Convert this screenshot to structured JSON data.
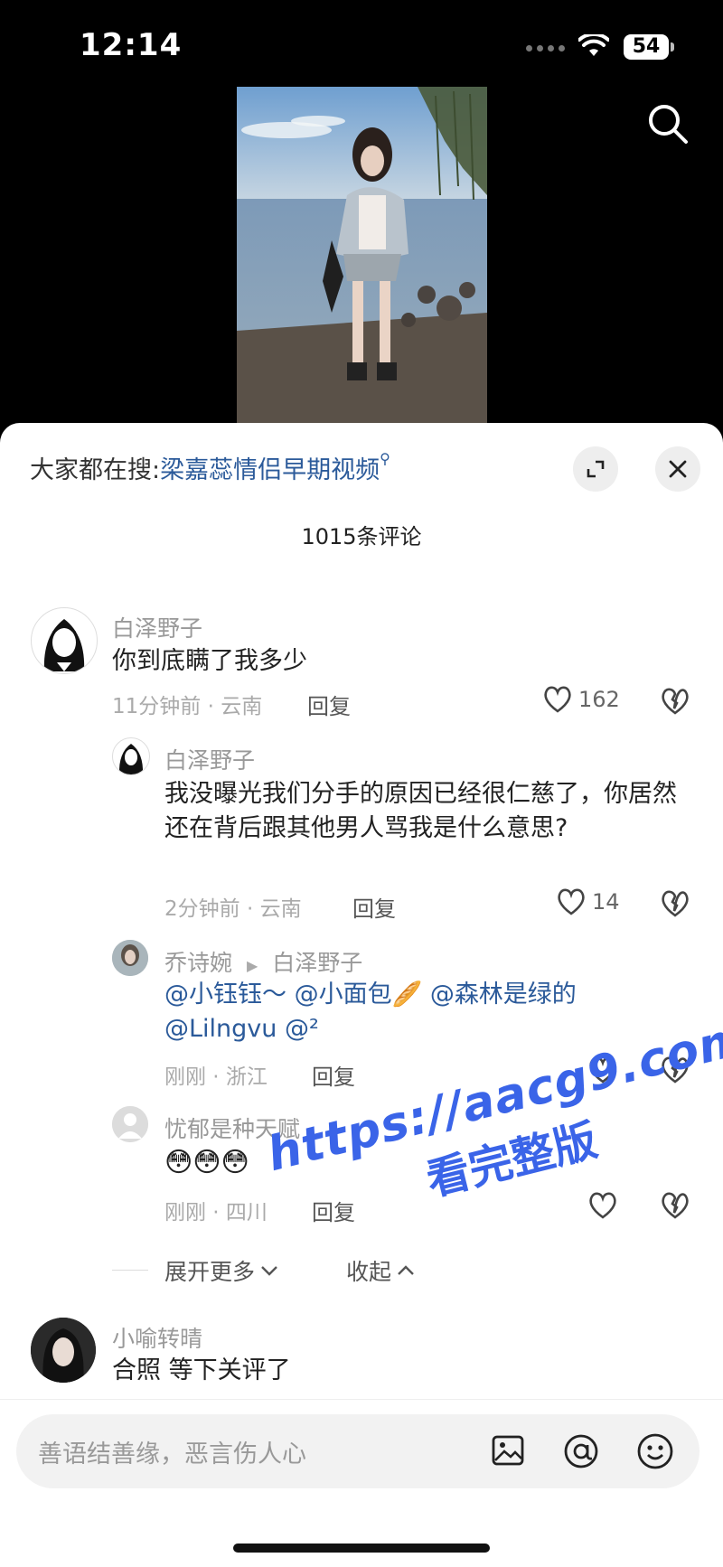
{
  "status": {
    "time": "12:14",
    "battery": "54"
  },
  "trending": {
    "prefix": "大家都在搜:",
    "keyword": "梁嘉蕊情侣早期视频"
  },
  "comment_count": "1015条评论",
  "comments": [
    {
      "user": "白泽野子",
      "text": "你到底瞒了我多少",
      "meta": "11分钟前 · 云南",
      "reply": "回复",
      "likes": "162"
    },
    {
      "user": "白泽野子",
      "text": "我没曝光我们分手的原因已经很仁慈了，你居然还在背后跟其他男人骂我是什么意思?",
      "meta": "2分钟前 · 云南",
      "reply": "回复",
      "likes": "14"
    },
    {
      "user": "乔诗婉",
      "reply_to": "白泽野子",
      "mentions": [
        "@小钰钰～",
        "@小面包🥖",
        "@森林是绿的",
        "@Lilngvu",
        "@²"
      ],
      "meta": "刚刚 · 浙江",
      "reply": "回复"
    },
    {
      "user": "忧郁是种天赋",
      "text": "😳😳😳",
      "meta": "刚刚 · 四川",
      "reply": "回复"
    },
    {
      "user": "小喻转晴",
      "text": "合照 等下关评了"
    }
  ],
  "expand": {
    "more": "展开更多",
    "collapse": "收起"
  },
  "watermark": {
    "line1": "https://aacg9.com",
    "line2": "看完整版"
  },
  "input": {
    "placeholder": "善语结善缘，恶言伤人心"
  }
}
